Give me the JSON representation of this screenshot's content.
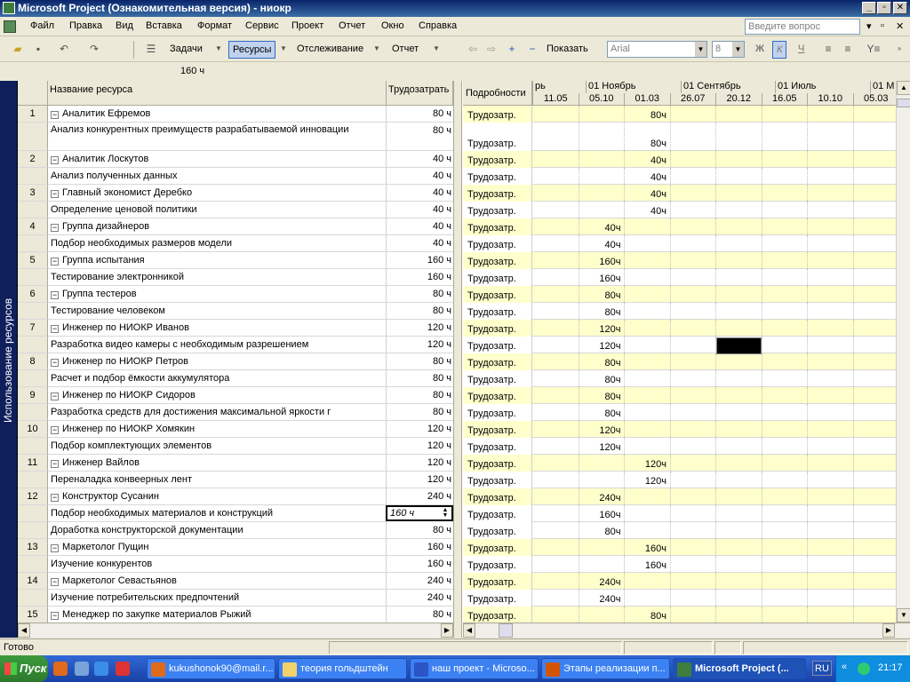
{
  "window": {
    "title": "Microsoft Project (Ознакомительная версия) - ниокр"
  },
  "menu": {
    "items": [
      "Файл",
      "Правка",
      "Вид",
      "Вставка",
      "Формат",
      "Сервис",
      "Проект",
      "Отчет",
      "Окно",
      "Справка"
    ],
    "help_placeholder": "Введите вопрос"
  },
  "toolbar": {
    "tasks_label": "Задачи",
    "resources_label": "Ресурсы",
    "tracking_label": "Отслеживание",
    "report_label": "Отчет",
    "show_label": "Показать",
    "font_name": "Arial",
    "font_size": "8",
    "bold": "Ж",
    "italic": "К",
    "underline": "Ч"
  },
  "entry_bar": {
    "value": "160 ч"
  },
  "view_bar": {
    "label": "Использование ресурсов"
  },
  "table": {
    "headers": {
      "name": "Название ресурса",
      "work": "Трудозатрать"
    },
    "rows": [
      {
        "id": "1",
        "name": "Аналитик Ефремов",
        "work": "80 ч",
        "type": "resource"
      },
      {
        "id": "",
        "name": "Анализ конкурентных преимуществ разрабатываемой инновации",
        "work": "80 ч",
        "type": "assignment",
        "two_line": true
      },
      {
        "id": "2",
        "name": "Аналитик Лоскутов",
        "work": "40 ч",
        "type": "resource"
      },
      {
        "id": "",
        "name": "Анализ полученных данных",
        "work": "40 ч",
        "type": "assignment"
      },
      {
        "id": "3",
        "name": "Главный экономист Деребко",
        "work": "40 ч",
        "type": "resource"
      },
      {
        "id": "",
        "name": "Определение ценовой политики",
        "work": "40 ч",
        "type": "assignment"
      },
      {
        "id": "4",
        "name": "Группа дизайнеров",
        "work": "40 ч",
        "type": "resource"
      },
      {
        "id": "",
        "name": "Подбор необходимых размеров модели",
        "work": "40 ч",
        "type": "assignment"
      },
      {
        "id": "5",
        "name": "Группа испытания",
        "work": "160 ч",
        "type": "resource"
      },
      {
        "id": "",
        "name": "Тестирование электронникой",
        "work": "160 ч",
        "type": "assignment"
      },
      {
        "id": "6",
        "name": "Группа тестеров",
        "work": "80 ч",
        "type": "resource"
      },
      {
        "id": "",
        "name": "Тестирование человеком",
        "work": "80 ч",
        "type": "assignment"
      },
      {
        "id": "7",
        "name": "Инженер по НИОКР Иванов",
        "work": "120 ч",
        "type": "resource"
      },
      {
        "id": "",
        "name": "Разработка видео камеры с необходимым разрешением",
        "work": "120 ч",
        "type": "assignment"
      },
      {
        "id": "8",
        "name": "Инженер по НИОКР Петров",
        "work": "80 ч",
        "type": "resource"
      },
      {
        "id": "",
        "name": "Расчет и подбор ёмкости аккумулятора",
        "work": "80 ч",
        "type": "assignment"
      },
      {
        "id": "9",
        "name": "Инженер по НИОКР Сидоров",
        "work": "80 ч",
        "type": "resource"
      },
      {
        "id": "",
        "name": "Разработка средств для достижения максимальной яркости г",
        "work": "80 ч",
        "type": "assignment"
      },
      {
        "id": "10",
        "name": "Инженер по НИОКР Хомякин",
        "work": "120 ч",
        "type": "resource"
      },
      {
        "id": "",
        "name": "Подбор комплектующих элементов",
        "work": "120 ч",
        "type": "assignment"
      },
      {
        "id": "11",
        "name": "Инженер Вайлов",
        "work": "120 ч",
        "type": "resource"
      },
      {
        "id": "",
        "name": "Переналадка конвеерных лент",
        "work": "120 ч",
        "type": "assignment"
      },
      {
        "id": "12",
        "name": "Конструктор Сусанин",
        "work": "240 ч",
        "type": "resource"
      },
      {
        "id": "",
        "name": "Подбор необходимых материалов и конструкций",
        "work": "160 ч",
        "type": "assignment",
        "editing": true
      },
      {
        "id": "",
        "name": "Доработка конструкторской документации",
        "work": "80 ч",
        "type": "assignment"
      },
      {
        "id": "13",
        "name": "Маркетолог Пущин",
        "work": "160 ч",
        "type": "resource"
      },
      {
        "id": "",
        "name": "Изучение конкурентов",
        "work": "160 ч",
        "type": "assignment"
      },
      {
        "id": "14",
        "name": "Маркетолог Севастьянов",
        "work": "240 ч",
        "type": "resource"
      },
      {
        "id": "",
        "name": "Изучение потребительских предпочтений",
        "work": "240 ч",
        "type": "assignment"
      },
      {
        "id": "15",
        "name": "Менеджер по закупке материалов Рыжий",
        "work": "80 ч",
        "type": "resource"
      }
    ]
  },
  "grid": {
    "details_header": "Подробности",
    "detail_label": "Трудозатр.",
    "tier1": [
      "рь",
      "01 Ноябрь",
      "01 Сентябрь",
      "01 Июль",
      "01 М"
    ],
    "tier2": [
      "11.05",
      "05.10",
      "01.03",
      "26.07",
      "20.12",
      "16.05",
      "10.10",
      "05.03"
    ],
    "values": [
      {
        "col": 2,
        "val": "80ч"
      },
      {
        "col": 2,
        "val": "80ч"
      },
      {
        "col": 2,
        "val": "40ч"
      },
      {
        "col": 2,
        "val": "40ч"
      },
      {
        "col": 2,
        "val": "40ч"
      },
      {
        "col": 2,
        "val": "40ч"
      },
      {
        "col": 1,
        "val": "40ч"
      },
      {
        "col": 1,
        "val": "40ч"
      },
      {
        "col": 1,
        "val": "160ч"
      },
      {
        "col": 1,
        "val": "160ч"
      },
      {
        "col": 1,
        "val": "80ч"
      },
      {
        "col": 1,
        "val": "80ч"
      },
      {
        "col": 1,
        "val": "120ч"
      },
      {
        "col": 1,
        "val": "120ч"
      },
      {
        "col": 1,
        "val": "80ч"
      },
      {
        "col": 1,
        "val": "80ч"
      },
      {
        "col": 1,
        "val": "80ч"
      },
      {
        "col": 1,
        "val": "80ч"
      },
      {
        "col": 1,
        "val": "120ч"
      },
      {
        "col": 1,
        "val": "120ч"
      },
      {
        "col": 2,
        "val": "120ч"
      },
      {
        "col": 2,
        "val": "120ч"
      },
      {
        "col": 1,
        "val": "240ч"
      },
      {
        "col": 1,
        "val": "160ч"
      },
      {
        "col": 1,
        "val": "80ч"
      },
      {
        "col": 2,
        "val": "160ч"
      },
      {
        "col": 2,
        "val": "160ч"
      },
      {
        "col": 1,
        "val": "240ч"
      },
      {
        "col": 1,
        "val": "240ч"
      },
      {
        "col": 2,
        "val": "80ч"
      }
    ]
  },
  "status": {
    "text": "Готово"
  },
  "taskbar": {
    "start_label": "Пуск",
    "tasks": [
      {
        "label": "kukushonok90@mail.r...",
        "active": false
      },
      {
        "label": "теория гольдштейн",
        "active": false
      },
      {
        "label": "наш проект - Microso...",
        "active": false
      },
      {
        "label": "Этапы реализации п...",
        "active": false
      },
      {
        "label": "Microsoft Project (...",
        "active": true
      }
    ],
    "lang": "RU",
    "clock": "21:17"
  }
}
